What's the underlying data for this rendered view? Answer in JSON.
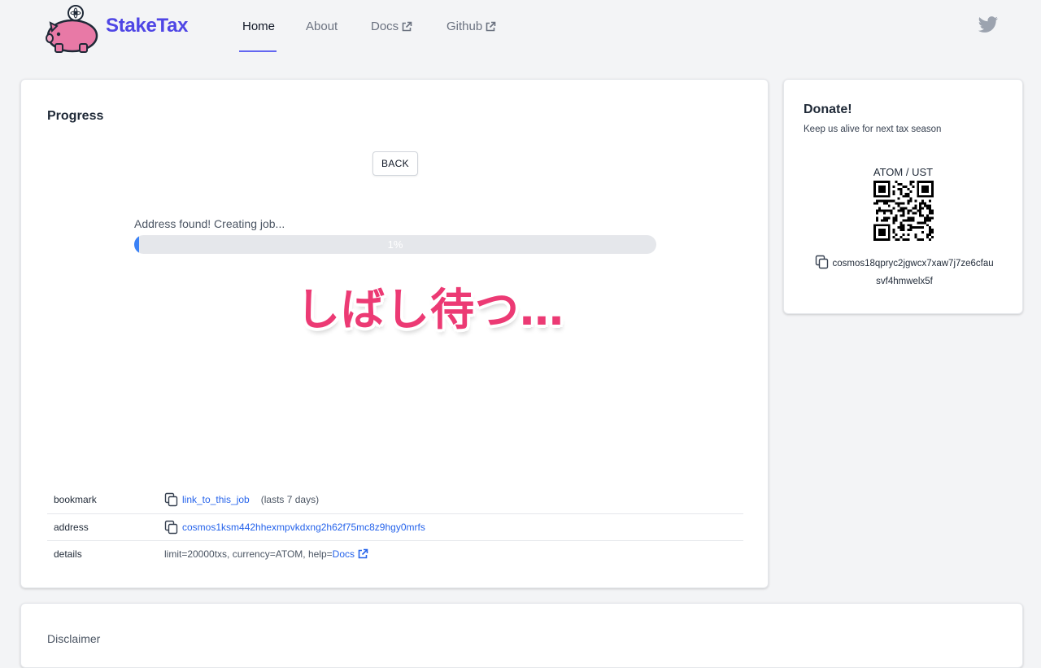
{
  "nav": {
    "brand": "StakeTax",
    "links": [
      {
        "label": "Home",
        "active": true
      },
      {
        "label": "About",
        "active": false
      },
      {
        "label": "Docs",
        "external": true
      },
      {
        "label": "Github",
        "external": true
      }
    ],
    "social_icon": "twitter-icon",
    "accent_color": "#4f46e5"
  },
  "progress": {
    "title": "Progress",
    "back_label": "BACK",
    "status": "Address found! Creating job...",
    "percent": 1,
    "percent_label": "1%",
    "overlay": "しばし待つ…",
    "table": {
      "bookmark_key": "bookmark",
      "bookmark_link": "link_to_this_job",
      "bookmark_note": "(lasts 7 days)",
      "address_key": "address",
      "address_value": "cosmos1ksm442hhexmpvkdxng2h62f75mc8z9hgy0mrfs",
      "details_key": "details",
      "details_prefix": "limit=20000txs, currency=ATOM, help=",
      "details_link": "Docs"
    }
  },
  "donate": {
    "title": "Donate!",
    "subtitle": "Keep us alive for next tax season",
    "label": "ATOM / UST",
    "address_line1": "cosmos18qpryc2jgwcx7xaw7j7ze6cfau",
    "address_line2": "svf4hmwelx5f"
  },
  "disclaimer": {
    "title": "Disclaimer"
  }
}
